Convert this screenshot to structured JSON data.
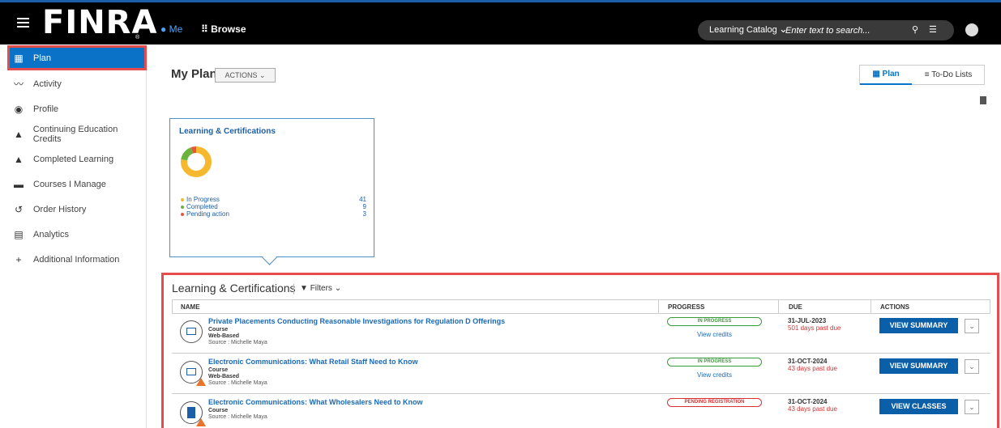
{
  "header": {
    "logo": "FINRA",
    "nav_me": "Me",
    "nav_browse": "Browse",
    "search_category": "Learning Catalog",
    "search_placeholder": "Enter text to search..."
  },
  "sidebar": {
    "items": [
      {
        "label": "Plan",
        "icon": "dashboard-icon",
        "active": true
      },
      {
        "label": "Activity",
        "icon": "activity-trend-icon"
      },
      {
        "label": "Profile",
        "icon": "profile-icon"
      },
      {
        "label": "Continuing Education Credits",
        "icon": "graduation-cap-icon"
      },
      {
        "label": "Completed Learning",
        "icon": "completed-learning-icon"
      },
      {
        "label": "Courses I Manage",
        "icon": "book-icon"
      },
      {
        "label": "Order History",
        "icon": "history-icon"
      },
      {
        "label": "Analytics",
        "icon": "analytics-icon"
      },
      {
        "label": "Additional Information",
        "icon": "plus-icon"
      }
    ]
  },
  "main": {
    "title": "My Plan",
    "actions_label": "ACTIONS",
    "tab_plan": "Plan",
    "tab_todo": "To-Do Lists"
  },
  "card": {
    "title": "Learning & Certifications",
    "legend": [
      {
        "label": "In Progress",
        "count": "41",
        "color": "#f5b82e"
      },
      {
        "label": "Completed",
        "count": "9",
        "color": "#6cb33e"
      },
      {
        "label": "Pending action",
        "count": "3",
        "color": "#e8573a"
      }
    ]
  },
  "section": {
    "title": "Learning & Certifications",
    "filters_label": "Filters",
    "columns": [
      "NAME",
      "PROGRESS",
      "DUE",
      "ACTIONS"
    ],
    "rows": [
      {
        "title": "Private Placements Conducting Reasonable Investigations for Regulation D Offerings",
        "type": "Course",
        "mode": "Web-Based",
        "source": "Source : Michelle Maya",
        "progress": "IN PROGRESS",
        "credits": "View credits",
        "due": "31-JUL-2023",
        "past_due": "501 days past due",
        "action": "VIEW SUMMARY"
      },
      {
        "title": "Electronic Communications: What Retail Staff Need to Know",
        "type": "Course",
        "mode": "Web-Based",
        "source": "Source : Michelle Maya",
        "progress": "IN PROGRESS",
        "credits": "View credits",
        "due": "31-OCT-2024",
        "past_due": "43 days past due",
        "action": "VIEW SUMMARY"
      },
      {
        "title": "Electronic Communications: What Wholesalers Need to Know",
        "type": "Course",
        "source": "Source : Michelle Maya",
        "progress": "PENDING REGISTRATION",
        "due": "31-OCT-2024",
        "past_due": "43 days past due",
        "action": "VIEW CLASSES"
      }
    ]
  }
}
